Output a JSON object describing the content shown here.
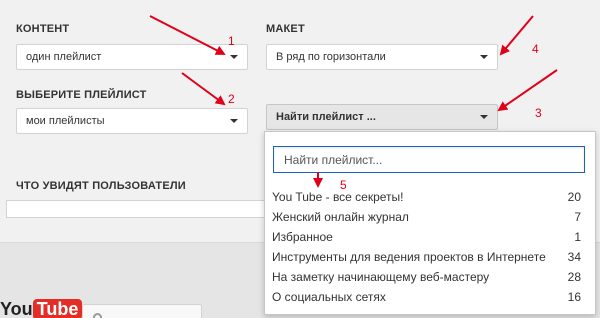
{
  "content": {
    "label": "КОНТЕНТ",
    "value": "один плейлист"
  },
  "layout": {
    "label": "МАКЕТ",
    "value": "В ряд по горизонтали"
  },
  "playlist_choice": {
    "label": "ВЫБЕРИТЕ ПЛЕЙЛИСТ",
    "value": "мои плейлисты"
  },
  "find_playlist": {
    "value": "Найти плейлист ..."
  },
  "users_view": {
    "label": "ЧТО УВИДЯТ ПОЛЬЗОВАТЕЛИ"
  },
  "dropdown": {
    "search_placeholder": "Найти плейлист...",
    "items": [
      {
        "name": "You Tube - все секреты!",
        "count": "20"
      },
      {
        "name": "Женский онлайн журнал",
        "count": "7"
      },
      {
        "name": "Избранное",
        "count": "1"
      },
      {
        "name": "Инструменты для ведения проектов в Интернете",
        "count": "34"
      },
      {
        "name": "На заметку начинающему веб-мастеру",
        "count": "28"
      },
      {
        "name": "О социальных сетях",
        "count": "16"
      }
    ]
  },
  "logo": {
    "text_you": "You",
    "text_tube": "Tube"
  },
  "annotations": {
    "numbers": [
      "1",
      "2",
      "3",
      "4",
      "5"
    ],
    "color": "#e0001a"
  }
}
